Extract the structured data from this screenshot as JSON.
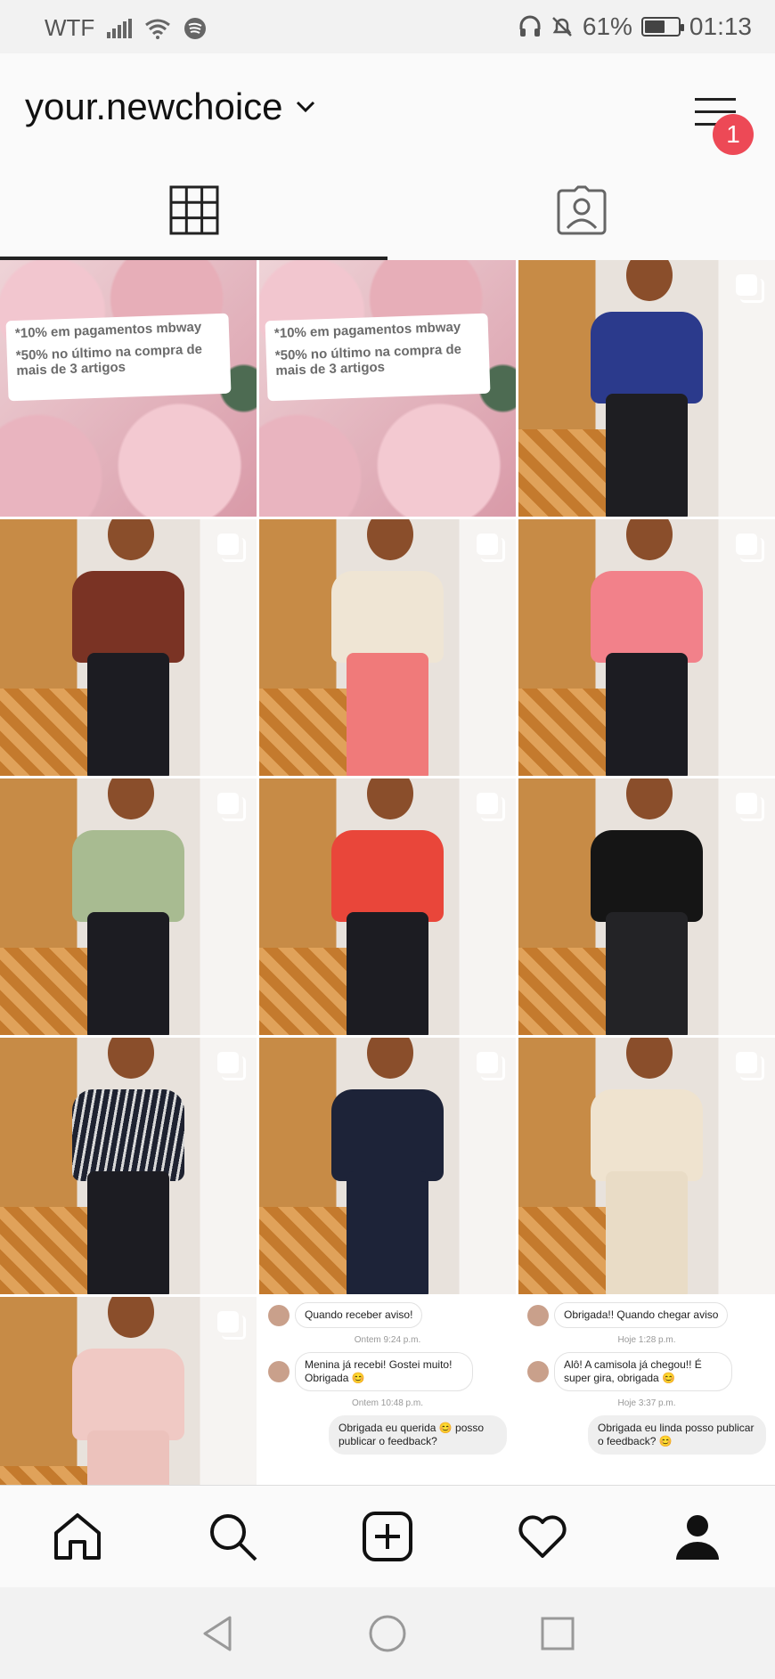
{
  "status_bar": {
    "carrier": "WTF",
    "battery_text": "61%",
    "battery_level": 0.61,
    "time": "01:13"
  },
  "header": {
    "username": "your.newchoice",
    "notification_count": "1"
  },
  "tabs": [
    {
      "name": "grid",
      "icon": "grid-icon",
      "active": true
    },
    {
      "name": "tagged",
      "icon": "tagged-icon",
      "active": false
    }
  ],
  "posts": {
    "promo": {
      "line1": "*10% em pagamentos mbway",
      "line2": "*50% no último na compra de mais de 3 artigos"
    },
    "chat_left": {
      "msg1": "Quando receber aviso!",
      "time1": "Ontem 9:24 p.m.",
      "msg2": "Menina já recebi! Gostei muito! Obrigada 😊",
      "time2": "Ontem 10:48 p.m.",
      "msg3": "Obrigada eu querida 😊 posso publicar o feedback?"
    },
    "chat_right": {
      "msg1": "Obrigada!! Quando chegar aviso",
      "time1": "Hoje 1:28 p.m.",
      "msg2": "Alô! A camisola já chegou!! É super gira, obrigada 😊",
      "time2": "Hoje 3:37 p.m.",
      "msg3": "Obrigada eu linda posso publicar o feedback? 😊"
    }
  },
  "bottom_nav": [
    "home-icon",
    "search-icon",
    "add-post-icon",
    "activity-heart-icon",
    "profile-icon"
  ],
  "system_nav": [
    "back-icon",
    "home-circle-icon",
    "recents-icon"
  ],
  "colors": {
    "badge": "#ed4956",
    "text": "#111111"
  }
}
